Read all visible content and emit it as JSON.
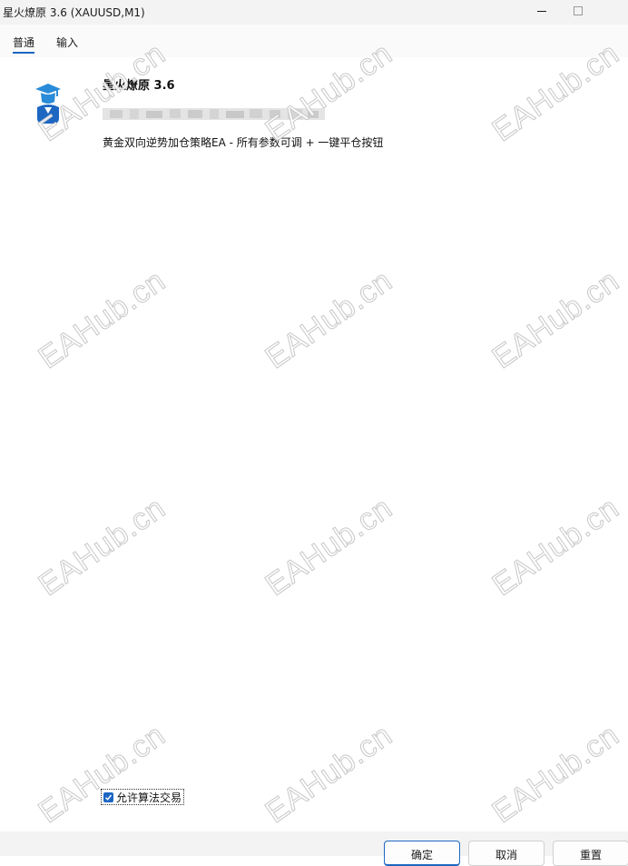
{
  "window": {
    "title": "星火燎原 3.6 (XAUUSD,M1)"
  },
  "tabs": [
    {
      "label": "普通",
      "active": true
    },
    {
      "label": "输入",
      "active": false
    }
  ],
  "expert": {
    "icon": "graduate-icon",
    "name": "星火燎原 3.6",
    "description": "黄金双向逆势加仓策略EA - 所有参数可调 + 一键平仓按钮"
  },
  "options": {
    "allow_algo_trading_label": "允许算法交易",
    "allow_algo_trading_checked": true
  },
  "footer": {
    "ok_label": "确定",
    "cancel_label": "取消",
    "reset_label": "重置"
  },
  "watermark": {
    "text": "EAHub.cn"
  },
  "colors": {
    "accent": "#1d67c2",
    "titlebar_bg": "#f3f3f3"
  }
}
